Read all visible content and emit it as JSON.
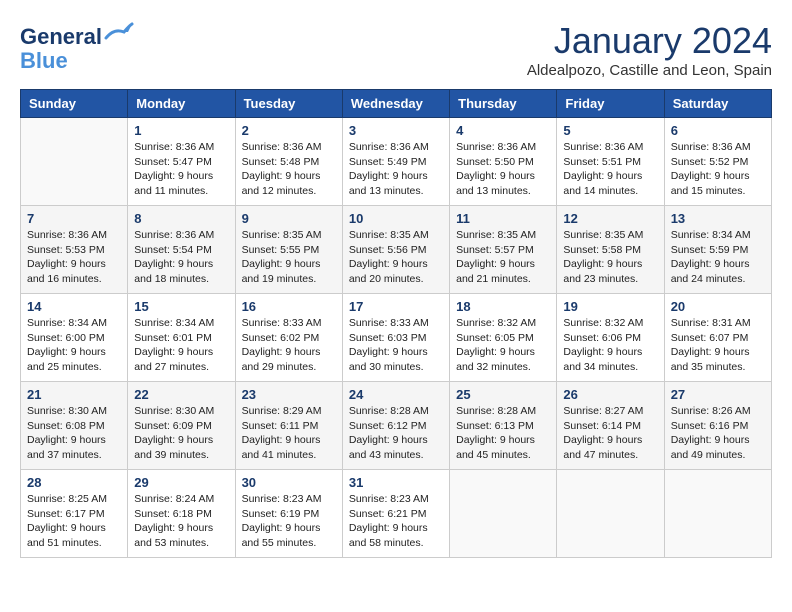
{
  "header": {
    "logo_line1": "General",
    "logo_line2": "Blue",
    "month_title": "January 2024",
    "location": "Aldealpozo, Castille and Leon, Spain"
  },
  "days_of_week": [
    "Sunday",
    "Monday",
    "Tuesday",
    "Wednesday",
    "Thursday",
    "Friday",
    "Saturday"
  ],
  "weeks": [
    [
      {
        "day": "",
        "info": ""
      },
      {
        "day": "1",
        "info": "Sunrise: 8:36 AM\nSunset: 5:47 PM\nDaylight: 9 hours\nand 11 minutes."
      },
      {
        "day": "2",
        "info": "Sunrise: 8:36 AM\nSunset: 5:48 PM\nDaylight: 9 hours\nand 12 minutes."
      },
      {
        "day": "3",
        "info": "Sunrise: 8:36 AM\nSunset: 5:49 PM\nDaylight: 9 hours\nand 13 minutes."
      },
      {
        "day": "4",
        "info": "Sunrise: 8:36 AM\nSunset: 5:50 PM\nDaylight: 9 hours\nand 13 minutes."
      },
      {
        "day": "5",
        "info": "Sunrise: 8:36 AM\nSunset: 5:51 PM\nDaylight: 9 hours\nand 14 minutes."
      },
      {
        "day": "6",
        "info": "Sunrise: 8:36 AM\nSunset: 5:52 PM\nDaylight: 9 hours\nand 15 minutes."
      }
    ],
    [
      {
        "day": "7",
        "info": "Sunrise: 8:36 AM\nSunset: 5:53 PM\nDaylight: 9 hours\nand 16 minutes."
      },
      {
        "day": "8",
        "info": "Sunrise: 8:36 AM\nSunset: 5:54 PM\nDaylight: 9 hours\nand 18 minutes."
      },
      {
        "day": "9",
        "info": "Sunrise: 8:35 AM\nSunset: 5:55 PM\nDaylight: 9 hours\nand 19 minutes."
      },
      {
        "day": "10",
        "info": "Sunrise: 8:35 AM\nSunset: 5:56 PM\nDaylight: 9 hours\nand 20 minutes."
      },
      {
        "day": "11",
        "info": "Sunrise: 8:35 AM\nSunset: 5:57 PM\nDaylight: 9 hours\nand 21 minutes."
      },
      {
        "day": "12",
        "info": "Sunrise: 8:35 AM\nSunset: 5:58 PM\nDaylight: 9 hours\nand 23 minutes."
      },
      {
        "day": "13",
        "info": "Sunrise: 8:34 AM\nSunset: 5:59 PM\nDaylight: 9 hours\nand 24 minutes."
      }
    ],
    [
      {
        "day": "14",
        "info": "Sunrise: 8:34 AM\nSunset: 6:00 PM\nDaylight: 9 hours\nand 25 minutes."
      },
      {
        "day": "15",
        "info": "Sunrise: 8:34 AM\nSunset: 6:01 PM\nDaylight: 9 hours\nand 27 minutes."
      },
      {
        "day": "16",
        "info": "Sunrise: 8:33 AM\nSunset: 6:02 PM\nDaylight: 9 hours\nand 29 minutes."
      },
      {
        "day": "17",
        "info": "Sunrise: 8:33 AM\nSunset: 6:03 PM\nDaylight: 9 hours\nand 30 minutes."
      },
      {
        "day": "18",
        "info": "Sunrise: 8:32 AM\nSunset: 6:05 PM\nDaylight: 9 hours\nand 32 minutes."
      },
      {
        "day": "19",
        "info": "Sunrise: 8:32 AM\nSunset: 6:06 PM\nDaylight: 9 hours\nand 34 minutes."
      },
      {
        "day": "20",
        "info": "Sunrise: 8:31 AM\nSunset: 6:07 PM\nDaylight: 9 hours\nand 35 minutes."
      }
    ],
    [
      {
        "day": "21",
        "info": "Sunrise: 8:30 AM\nSunset: 6:08 PM\nDaylight: 9 hours\nand 37 minutes."
      },
      {
        "day": "22",
        "info": "Sunrise: 8:30 AM\nSunset: 6:09 PM\nDaylight: 9 hours\nand 39 minutes."
      },
      {
        "day": "23",
        "info": "Sunrise: 8:29 AM\nSunset: 6:11 PM\nDaylight: 9 hours\nand 41 minutes."
      },
      {
        "day": "24",
        "info": "Sunrise: 8:28 AM\nSunset: 6:12 PM\nDaylight: 9 hours\nand 43 minutes."
      },
      {
        "day": "25",
        "info": "Sunrise: 8:28 AM\nSunset: 6:13 PM\nDaylight: 9 hours\nand 45 minutes."
      },
      {
        "day": "26",
        "info": "Sunrise: 8:27 AM\nSunset: 6:14 PM\nDaylight: 9 hours\nand 47 minutes."
      },
      {
        "day": "27",
        "info": "Sunrise: 8:26 AM\nSunset: 6:16 PM\nDaylight: 9 hours\nand 49 minutes."
      }
    ],
    [
      {
        "day": "28",
        "info": "Sunrise: 8:25 AM\nSunset: 6:17 PM\nDaylight: 9 hours\nand 51 minutes."
      },
      {
        "day": "29",
        "info": "Sunrise: 8:24 AM\nSunset: 6:18 PM\nDaylight: 9 hours\nand 53 minutes."
      },
      {
        "day": "30",
        "info": "Sunrise: 8:23 AM\nSunset: 6:19 PM\nDaylight: 9 hours\nand 55 minutes."
      },
      {
        "day": "31",
        "info": "Sunrise: 8:23 AM\nSunset: 6:21 PM\nDaylight: 9 hours\nand 58 minutes."
      },
      {
        "day": "",
        "info": ""
      },
      {
        "day": "",
        "info": ""
      },
      {
        "day": "",
        "info": ""
      }
    ]
  ]
}
